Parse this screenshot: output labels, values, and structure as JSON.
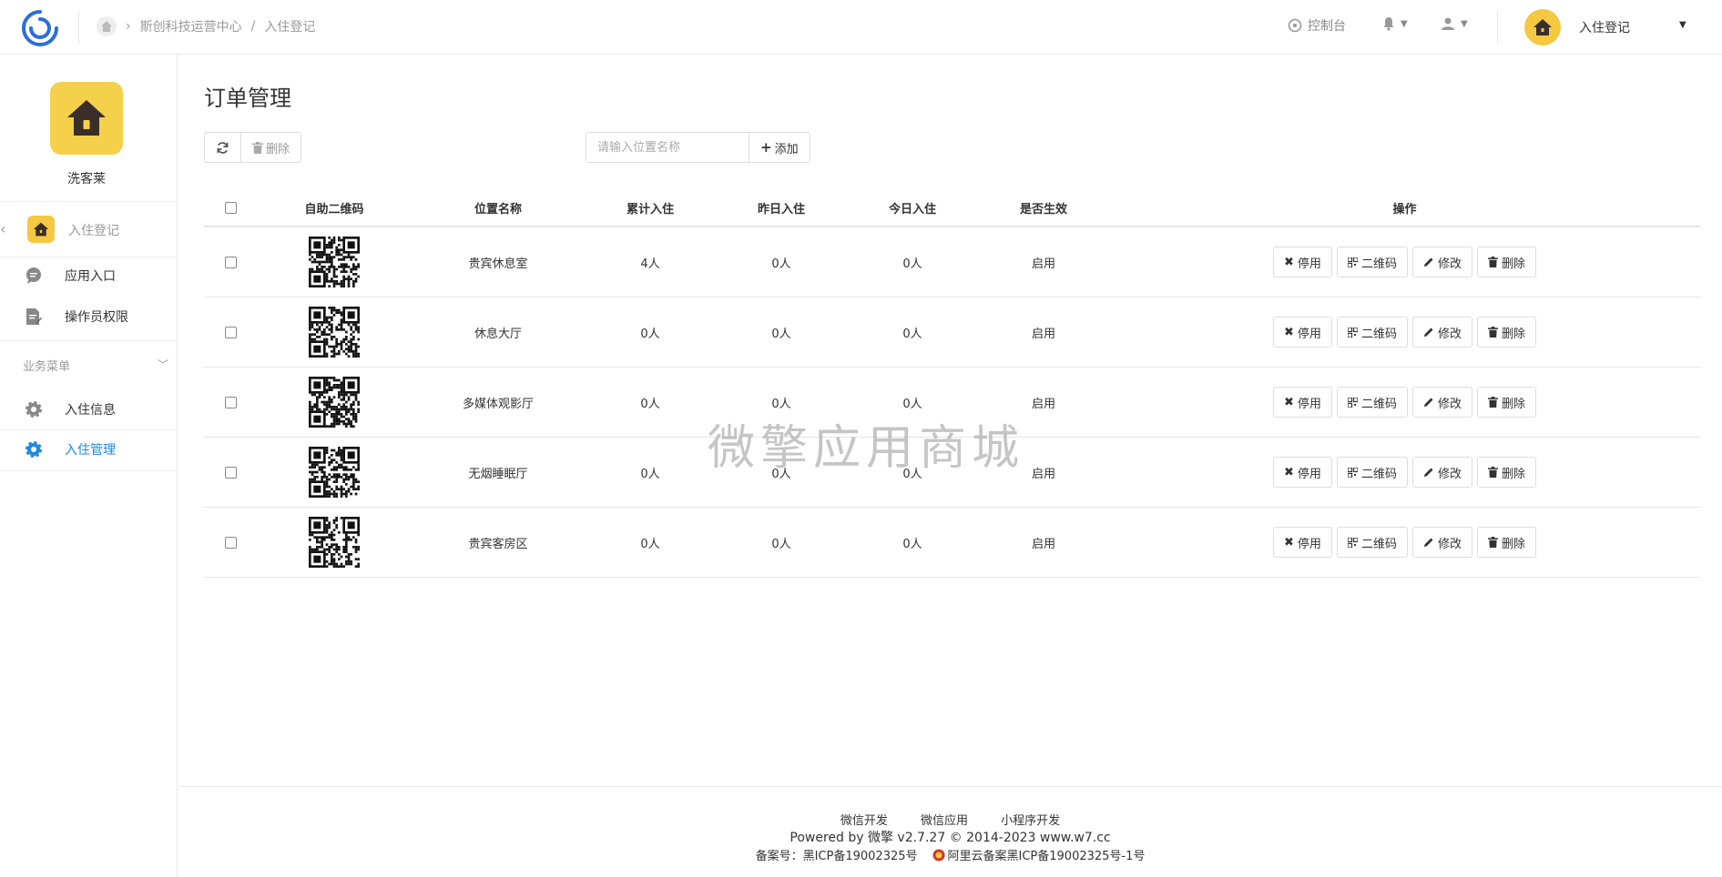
{
  "topbar": {
    "breadcrumb_org": "斯创科技运营中心",
    "breadcrumb_sep": "/",
    "breadcrumb_page": "入住登记",
    "console_label": "控制台",
    "user_name": "入住登记"
  },
  "sidebar": {
    "app_name": "洗客莱",
    "current_label": "入住登记",
    "items": [
      {
        "label": "应用入口",
        "icon": "chat-icon"
      },
      {
        "label": "操作员权限",
        "icon": "document-edit-icon"
      }
    ],
    "group_label": "业务菜单",
    "group_items": [
      {
        "label": "入住信息",
        "icon": "gear-icon"
      },
      {
        "label": "入住管理",
        "icon": "gear-icon",
        "active": true
      }
    ]
  },
  "main": {
    "title": "订单管理",
    "refresh_icon": "refresh-icon",
    "delete_label": "删除",
    "search_placeholder": "请输入位置名称",
    "add_label": "添加"
  },
  "table": {
    "headers": [
      "自助二维码",
      "位置名称",
      "累计入住",
      "昨日入住",
      "今日入住",
      "是否生效",
      "操作"
    ],
    "rows": [
      {
        "name": "贵宾休息室",
        "total": "4人",
        "yesterday": "0人",
        "today": "0人",
        "status": "启用"
      },
      {
        "name": "休息大厅",
        "total": "0人",
        "yesterday": "0人",
        "today": "0人",
        "status": "启用"
      },
      {
        "name": "多媒体观影厅",
        "total": "0人",
        "yesterday": "0人",
        "today": "0人",
        "status": "启用"
      },
      {
        "name": "无烟睡眠厅",
        "total": "0人",
        "yesterday": "0人",
        "today": "0人",
        "status": "启用"
      },
      {
        "name": "贵宾客房区",
        "total": "0人",
        "yesterday": "0人",
        "today": "0人",
        "status": "启用"
      }
    ],
    "actions": {
      "disable": "停用",
      "qrcode": "二维码",
      "edit": "修改",
      "delete": "删除"
    }
  },
  "watermark": "微擎应用商城",
  "footer": {
    "links": [
      "微信开发",
      "微信应用",
      "小程序开发"
    ],
    "powered": "Powered by 微擎 v2.7.27 © 2014-2023 www.w7.cc",
    "icp1": "备案号：黑ICP备19002325号",
    "icp2": "阿里云备案黑ICP备19002325号-1号"
  },
  "colors": {
    "accent": "#1e88e5",
    "logo_yellow": "#f5c842"
  }
}
